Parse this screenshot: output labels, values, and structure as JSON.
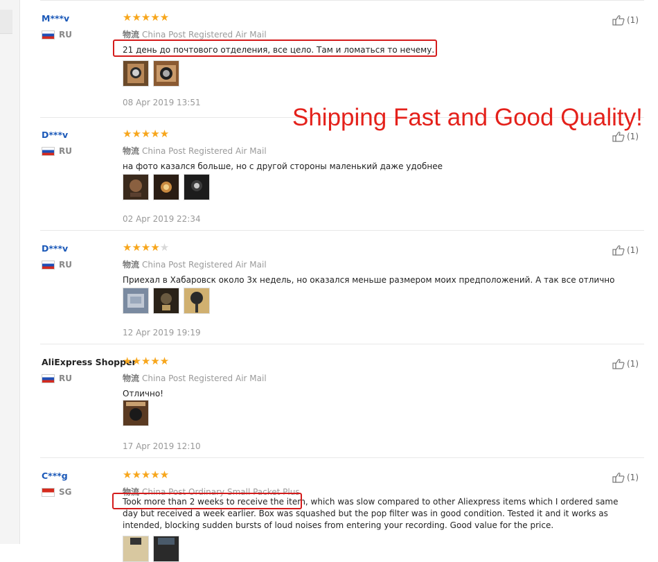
{
  "overlay": {
    "caption": "Shipping Fast and Good Quality!"
  },
  "colors": {
    "accent_red": "#e4211b",
    "star": "#f7a61c",
    "username_blue": "#1a58b8"
  },
  "reviews": [
    {
      "user": "M***v",
      "country": "RU",
      "flag": "ru",
      "rating": 5,
      "shipping_label": "物流",
      "shipping_method": "China Post Registered Air Mail",
      "text": "21 день до почтового отделения, все цело. Там и ломаться то нечему.",
      "photo_count": 2,
      "date": "08 Apr 2019 13:51",
      "helpful_count": "(1)"
    },
    {
      "user": "D***v",
      "country": "RU",
      "flag": "ru",
      "rating": 5,
      "shipping_label": "物流",
      "shipping_method": "China Post Registered Air Mail",
      "text": "на фото казался больше, но с другой стороны маленький даже удобнее",
      "photo_count": 3,
      "date": "02 Apr 2019 22:34",
      "helpful_count": "(1)"
    },
    {
      "user": "D***v",
      "country": "RU",
      "flag": "ru",
      "rating": 4,
      "shipping_label": "物流",
      "shipping_method": "China Post Registered Air Mail",
      "text": "Приехал в Хабаровск около 3х недель, но оказался меньше размером моих предположений. А так все отлично",
      "photo_count": 3,
      "date": "12 Apr 2019 19:19",
      "helpful_count": "(1)"
    },
    {
      "user": "AliExpress Shopper",
      "country": "RU",
      "flag": "ru",
      "rating": 5,
      "shipping_label": "物流",
      "shipping_method": "China Post Registered Air Mail",
      "text": "Отлично!",
      "photo_count": 1,
      "date": "17 Apr 2019 12:10",
      "helpful_count": "(1)"
    },
    {
      "user": "C***g",
      "country": "SG",
      "flag": "sg",
      "rating": 5,
      "shipping_label": "物流",
      "shipping_method": "China Post Ordinary Small Packet Plus",
      "text": "Took more than 2 weeks to receive the item, which was slow compared to other Aliexpress items which I ordered same day but received a week earlier. Box was squashed but the pop filter was in good condition. Tested it and it works as intended, blocking sudden bursts of loud noises from entering your recording. Good value for the price.",
      "photo_count": 2,
      "date": "",
      "helpful_count": "(1)"
    }
  ]
}
